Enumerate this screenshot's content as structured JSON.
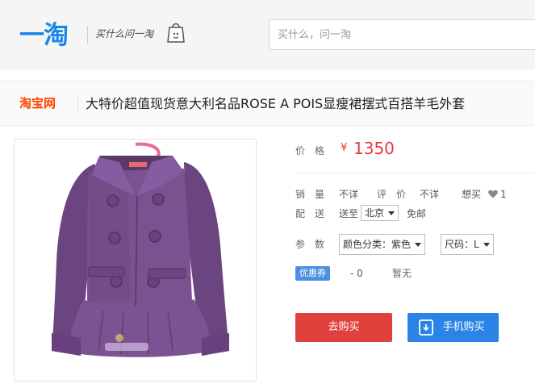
{
  "header": {
    "logo": "一淘",
    "slogan": "买什么问一淘",
    "search_placeholder": "买什么，问一淘"
  },
  "title_bar": {
    "site_logo": "淘宝网",
    "product_title": "大特价超值现货意大利名品ROSE A POIS显瘦裙摆式百搭羊毛外套"
  },
  "info": {
    "price_label": "价　格",
    "currency": "¥",
    "price": "1350",
    "sales_label": "销　量",
    "sales_value": "不详",
    "review_label": "评　价",
    "review_value": "不详",
    "want_label": "想买",
    "want_count": "1",
    "ship_label": "配　送",
    "ship_to": "送至",
    "ship_city": "北京",
    "ship_fee": "免邮",
    "param_label": "参　数",
    "color_option": "颜色分类：紫色",
    "size_option": "尺码：L",
    "coupon_badge": "优惠券",
    "coupon_value": "- 0",
    "coupon_status": "暂无",
    "buy_button": "去购买",
    "mobile_button": "手机购买"
  },
  "colors": {
    "brand_blue": "#1a86e8",
    "price_red": "#e4393c",
    "buy_red": "#e0413d",
    "mobile_blue": "#2a84e6",
    "coat_purple": "#6f4a82"
  }
}
